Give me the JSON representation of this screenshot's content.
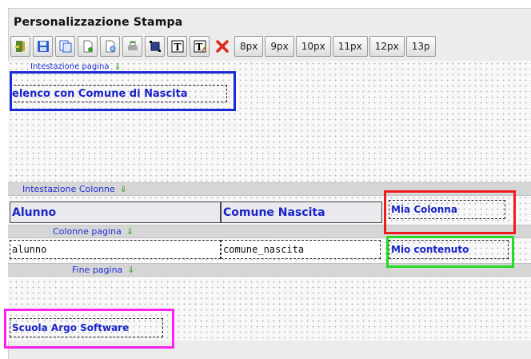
{
  "window": {
    "title": "Personalizzazione Stampa"
  },
  "toolbar": {
    "icons": [
      "exit-icon",
      "save-icon",
      "copy-icon",
      "new-page-icon",
      "preview-icon",
      "print-icon",
      "select-icon",
      "text-icon",
      "text-edit-icon",
      "delete-icon"
    ],
    "font_sizes": [
      "8px",
      "9px",
      "10px",
      "11px",
      "12px",
      "13p"
    ]
  },
  "bands": {
    "page_header": "Intestazione pagina",
    "column_header": "Intestazione Colonne",
    "column_body": "Colonne pagina",
    "page_footer": "Fine pagina",
    "arrow": "⇓"
  },
  "fields": {
    "report_title": "elenco con Comune di Nascita",
    "col1_header": "Alunno",
    "col2_header": "Comune Nascita",
    "col3_header": "Mia Colonna",
    "col1_value": "alunno",
    "col2_value": "comune_nascita",
    "col3_value": "Mio contenuto",
    "footer_text": "Scuola Argo Software"
  },
  "highlight_colors": {
    "title": "#1a2ad6",
    "column_header": "#ee1c1c",
    "column_value": "#22dd22",
    "footer": "#ff22ee"
  }
}
